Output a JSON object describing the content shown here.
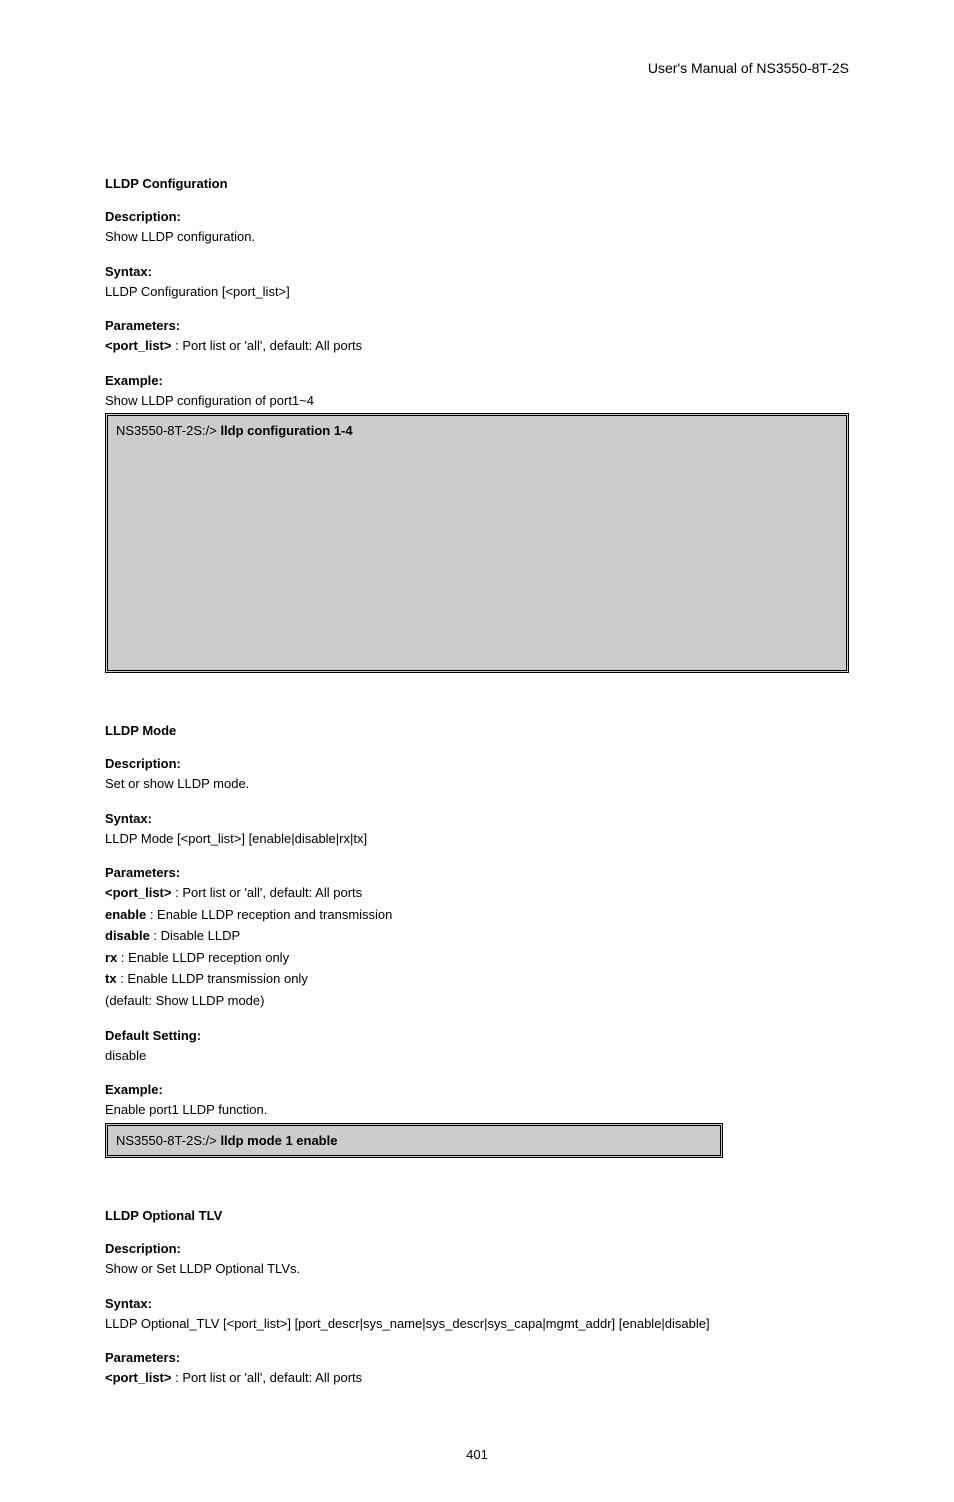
{
  "header": "User's  Manual  of  NS3550-8T-2S",
  "pageNumber": "401",
  "sections": [
    {
      "title": "LLDP Configuration",
      "descLabel": "Description:",
      "desc": "Show LLDP configuration.",
      "syntaxLabel": "Syntax:",
      "syntax": "LLDP Configuration [<port_list>]",
      "paramsLabel": "Parameters:",
      "params": [
        {
          "name": "<port_list>",
          "text": ": Port list or 'all', default: All ports"
        }
      ],
      "exampleLabel": "Example:",
      "example": "Show LLDP configuration of port1~4",
      "terminal": "NS3550-8T-2S:/>",
      "terminalCmd": "lldp configuration 1-4",
      "terminalTall": true
    },
    {
      "title": "LLDP Mode",
      "descLabel": "Description:",
      "desc": "Set or show LLDP mode.",
      "syntaxLabel": "Syntax:",
      "syntax": "LLDP Mode [<port_list>]    [enable|disable|rx|tx]",
      "paramsLabel": "Parameters:",
      "params": [
        {
          "name": "<port_list>",
          "text": ": Port list or 'all', default: All ports"
        },
        {
          "name": "enable",
          "text": ": Enable LLDP reception and transmission"
        },
        {
          "name": "disable",
          "text": ": Disable LLDP"
        },
        {
          "name": "rx",
          "text": ": Enable LLDP reception only"
        },
        {
          "name": "tx",
          "text": ": Enable LLDP transmission only"
        }
      ],
      "paramsTrailer": "(default: Show LLDP mode)",
      "defaultLabel": "Default Setting:",
      "defaultValue": " disable",
      "exampleLabel": "Example:",
      "example": "Enable port1 LLDP function.",
      "terminal": "NS3550-8T-2S:/>",
      "terminalCmd": "lldp mode 1 enable",
      "terminalTall": false
    },
    {
      "title": "LLDP Optional TLV",
      "descLabel": "Description:",
      "desc": "Show or Set LLDP Optional TLVs.",
      "syntaxLabel": "Syntax:",
      "syntax": "LLDP Optional_TLV [<port_list>] [port_descr|sys_name|sys_descr|sys_capa|mgmt_addr] [enable|disable]",
      "paramsLabel": "Parameters:",
      "params": [
        {
          "name": "<port_list>",
          "text": ": Port list or 'all', default: All ports"
        }
      ]
    }
  ]
}
